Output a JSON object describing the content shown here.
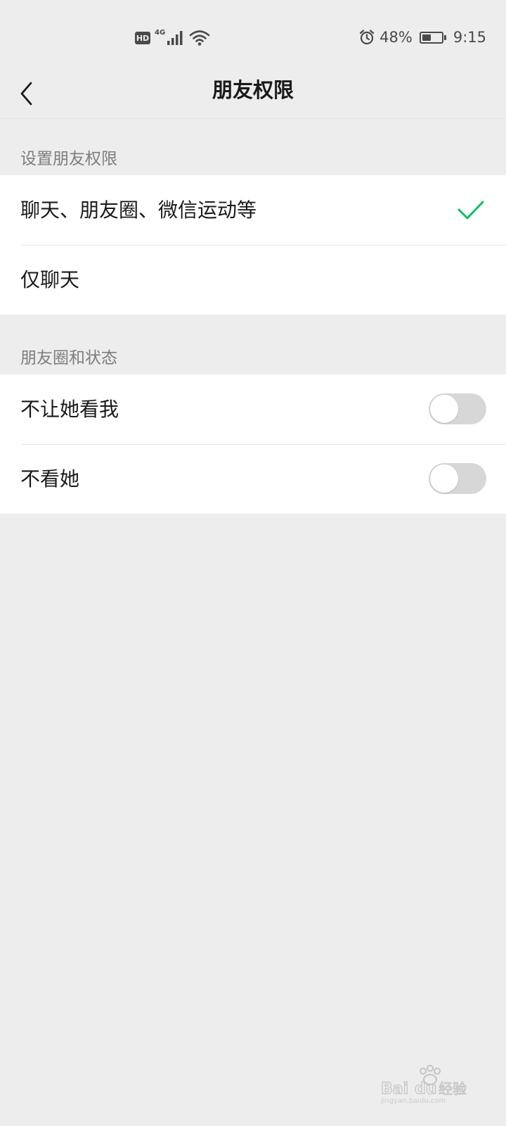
{
  "status_bar": {
    "hd_label": "HD",
    "network_label": "4G",
    "battery_text": "48%",
    "battery_level": 48,
    "time": "9:15",
    "icons": [
      "signal-icon",
      "wifi-icon",
      "alarm-icon",
      "battery-icon"
    ]
  },
  "nav": {
    "title": "朋友权限",
    "back_icon": "chevron-left-icon"
  },
  "permission_section": {
    "label": "设置朋友权限",
    "options": [
      {
        "label": "聊天、朋友圈、微信运动等",
        "selected": true
      },
      {
        "label": "仅聊天",
        "selected": false
      }
    ]
  },
  "moments_section": {
    "label": "朋友圈和状态",
    "toggles": [
      {
        "label": "不让她看我",
        "on": false
      },
      {
        "label": "不看她",
        "on": false
      }
    ]
  },
  "colors": {
    "accent_green": "#07c160",
    "background": "#ededed",
    "toggle_off": "#d7d7d7"
  }
}
